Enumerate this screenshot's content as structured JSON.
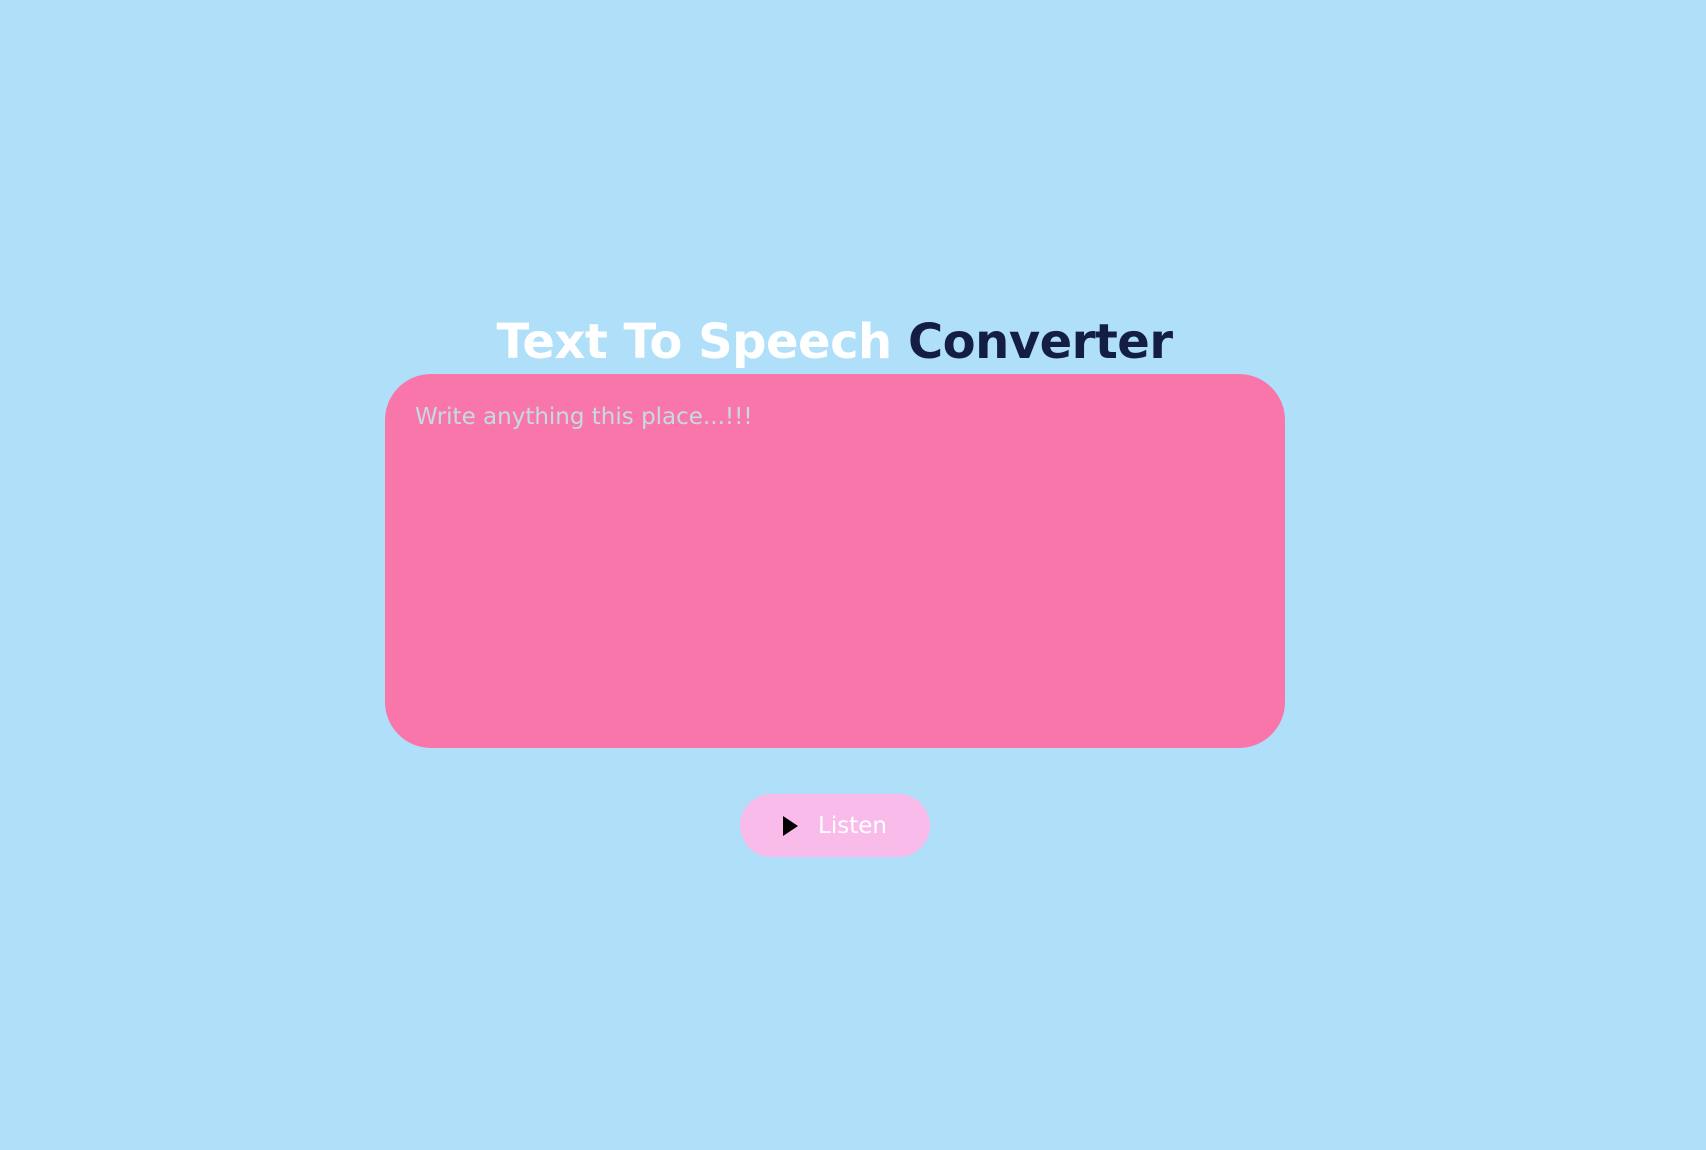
{
  "header": {
    "title_part1": "Text To Speech",
    "title_part2": "Converter"
  },
  "editor": {
    "placeholder": "Write anything this place...!!!",
    "value": ""
  },
  "actions": {
    "listen_label": "Listen",
    "listen_icon": "play-icon"
  },
  "colors": {
    "background": "#b0dffa",
    "editor_background": "#f876aa",
    "button_background": "#f9bcea",
    "title_light": "#ffffff",
    "title_dark": "#131d45"
  }
}
